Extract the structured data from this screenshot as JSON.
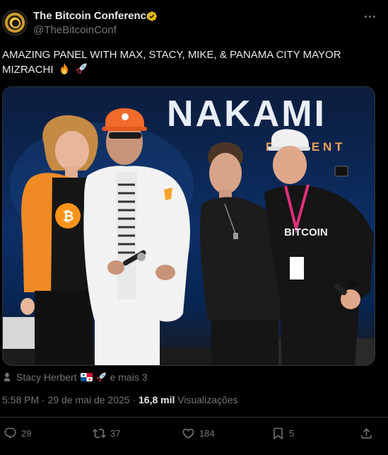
{
  "author": {
    "display_name": "The Bitcoin Conference",
    "handle": "@TheBitcoinConf",
    "verified_color": "#e2b719"
  },
  "tweet": {
    "text_line1": "AMAZING PANEL WITH MAX, STACY, MIKE, & PANAMA CITY MAYOR",
    "text_line2": "MIZRACHI",
    "emojis": [
      "fire",
      "rocket"
    ]
  },
  "photo": {
    "banner_text": "NAKAMI",
    "banner_subtext": "P R E S E N T",
    "shirt_text_1": "BITCOIN",
    "people_count": 4
  },
  "tagged": {
    "name": "Stacy Herbert",
    "and_more": "e mais 3"
  },
  "meta": {
    "timestamp": "5:58 PM · 29 de mai de 2025 · ",
    "views_count": "16,8 mil",
    "views_label": " Visualizações"
  },
  "actions": {
    "replies": "29",
    "retweets": "37",
    "likes": "184",
    "bookmarks": "5"
  },
  "colors": {
    "background": "#000000",
    "text_primary": "#e7e9ea",
    "text_secondary": "#71767b",
    "divider": "#2f3336",
    "stage_blue": "#0a2a5e"
  }
}
